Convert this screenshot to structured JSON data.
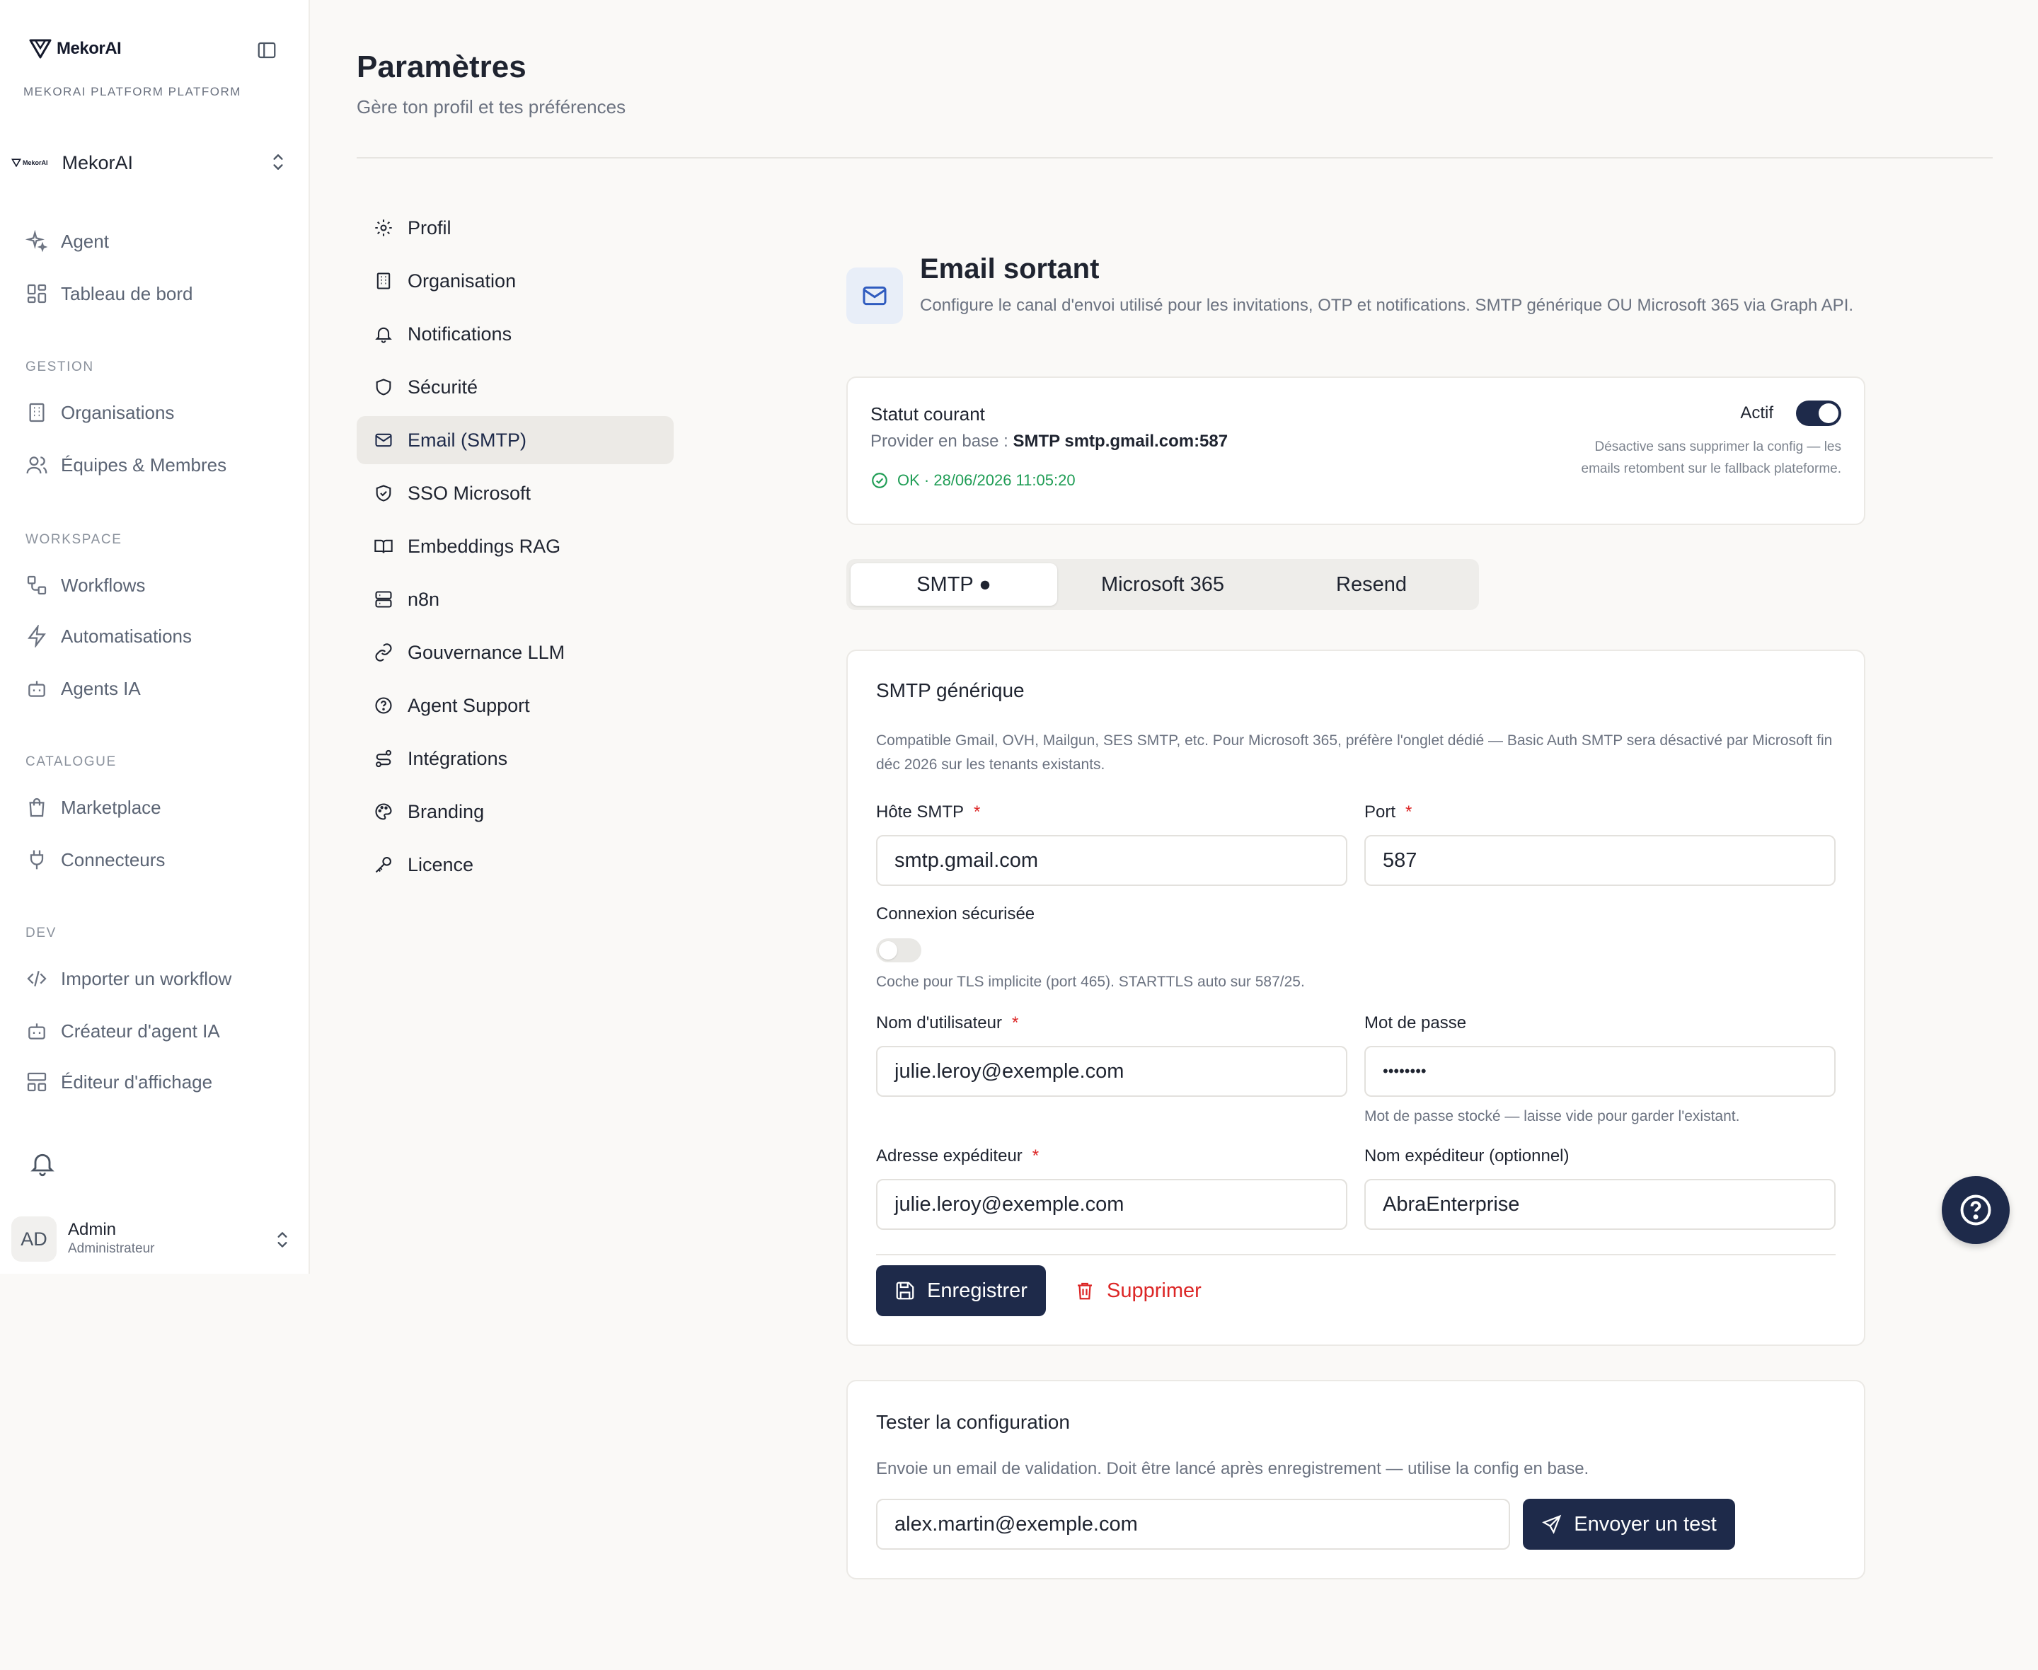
{
  "sidebar": {
    "logo_text": "MekorAI",
    "platform_label": "MEKORAI PLATFORM PLATFORM",
    "org": {
      "logo_text": "MekorAI",
      "name": "MekorAI"
    },
    "top_items": [
      {
        "label": "Agent",
        "icon": "sparkles-icon"
      },
      {
        "label": "Tableau de bord",
        "icon": "dashboard-icon"
      }
    ],
    "sections": [
      {
        "label": "GESTION",
        "items": [
          {
            "label": "Organisations",
            "icon": "building-icon"
          },
          {
            "label": "Équipes & Membres",
            "icon": "users-icon"
          }
        ]
      },
      {
        "label": "WORKSPACE",
        "items": [
          {
            "label": "Workflows",
            "icon": "workflow-icon"
          },
          {
            "label": "Automatisations",
            "icon": "zap-icon"
          },
          {
            "label": "Agents IA",
            "icon": "bot-icon"
          }
        ]
      },
      {
        "label": "CATALOGUE",
        "items": [
          {
            "label": "Marketplace",
            "icon": "shopping-bag-icon"
          },
          {
            "label": "Connecteurs",
            "icon": "plug-icon"
          }
        ]
      },
      {
        "label": "DEV",
        "items": [
          {
            "label": "Importer un workflow",
            "icon": "code-icon"
          },
          {
            "label": "Créateur d'agent IA",
            "icon": "bot-icon"
          },
          {
            "label": "Éditeur d'affichage",
            "icon": "layout-icon"
          }
        ]
      }
    ],
    "user": {
      "initials": "AD",
      "name": "Admin",
      "role": "Administrateur"
    }
  },
  "header": {
    "title": "Paramètres",
    "subtitle": "Gère ton profil et tes préférences"
  },
  "settings_nav": [
    {
      "label": "Profil",
      "icon": "gear-icon"
    },
    {
      "label": "Organisation",
      "icon": "building-icon"
    },
    {
      "label": "Notifications",
      "icon": "bell-icon"
    },
    {
      "label": "Sécurité",
      "icon": "shield-icon"
    },
    {
      "label": "Email (SMTP)",
      "icon": "mail-icon",
      "active": true
    },
    {
      "label": "SSO Microsoft",
      "icon": "shield-check-icon"
    },
    {
      "label": "Embeddings RAG",
      "icon": "book-icon"
    },
    {
      "label": "n8n",
      "icon": "server-icon"
    },
    {
      "label": "Gouvernance LLM",
      "icon": "link-icon"
    },
    {
      "label": "Agent Support",
      "icon": "help-circle-icon"
    },
    {
      "label": "Intégrations",
      "icon": "route-icon"
    },
    {
      "label": "Branding",
      "icon": "palette-icon"
    },
    {
      "label": "Licence",
      "icon": "key-icon"
    }
  ],
  "email": {
    "title": "Email sortant",
    "description": "Configure le canal d'envoi utilisé pour les invitations, OTP et notifications. SMTP générique OU Microsoft 365 via Graph API.",
    "status": {
      "title": "Statut courant",
      "provider_prefix": "Provider en base : ",
      "provider_value": "SMTP smtp.gmail.com:587",
      "ok_text": "OK · 28/06/2026 11:05:20",
      "active_label": "Actif",
      "active": true,
      "help": "Désactive sans supprimer la config — les emails retombent sur le fallback plateforme."
    },
    "tabs": [
      {
        "label": "SMTP ●",
        "active": true
      },
      {
        "label": "Microsoft 365",
        "active": false
      },
      {
        "label": "Resend",
        "active": false
      }
    ],
    "form": {
      "title": "SMTP générique",
      "description": "Compatible Gmail, OVH, Mailgun, SES SMTP, etc. Pour Microsoft 365, préfère l'onglet dédié — Basic Auth SMTP sera désactivé par Microsoft fin déc 2026 sur les tenants existants.",
      "host_label": "Hôte SMTP",
      "host_value": "smtp.gmail.com",
      "port_label": "Port",
      "port_value": "587",
      "secure_label": "Connexion sécurisée",
      "secure_enabled": false,
      "secure_hint": "Coche pour TLS implicite (port 465). STARTTLS auto sur 587/25.",
      "username_label": "Nom d'utilisateur",
      "username_value": "julie.leroy@exemple.com",
      "password_label": "Mot de passe",
      "password_value": "••••••••",
      "password_hint": "Mot de passe stocké — laisse vide pour garder l'existant.",
      "from_label": "Adresse expéditeur",
      "from_value": "julie.leroy@exemple.com",
      "from_name_label": "Nom expéditeur (optionnel)",
      "from_name_value": "AbraEnterprise",
      "required_mark": "*",
      "save_label": "Enregistrer",
      "delete_label": "Supprimer"
    },
    "test": {
      "title": "Tester la configuration",
      "description": "Envoie un email de validation. Doit être lancé après enregistrement — utilise la config en base.",
      "recipient_value": "alex.martin@exemple.com",
      "send_label": "Envoyer un test"
    }
  },
  "colors": {
    "primary": "#1e2a4a",
    "danger": "#dc2626",
    "success": "#1f9d55"
  }
}
